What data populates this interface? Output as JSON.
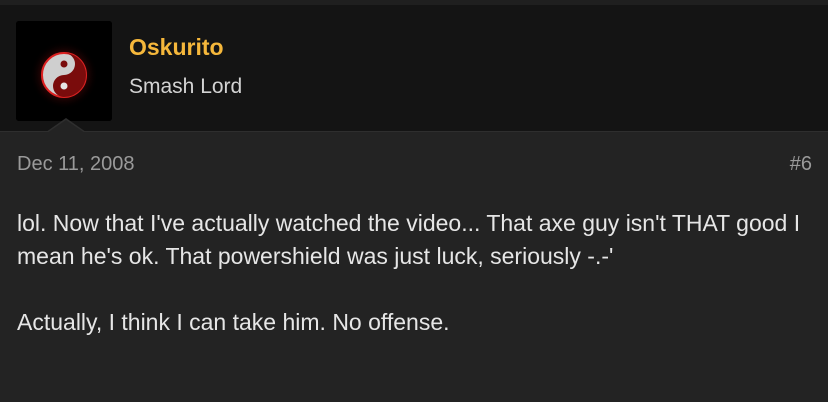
{
  "post": {
    "author": {
      "username": "Oskurito",
      "user_title": "Smash Lord",
      "avatar_icon": "yin-yang-icon"
    },
    "date": "Dec 11, 2008",
    "post_number": "#6",
    "message": {
      "paragraph_1": "lol. Now that I've actually watched the video... That axe guy isn't THAT good I mean he's ok. That powershield was just luck, seriously -.-'",
      "paragraph_2": "Actually, I think I can take him. No offense."
    }
  },
  "colors": {
    "username": "#f5b73b",
    "background": "#141414",
    "post_background": "#232323"
  }
}
